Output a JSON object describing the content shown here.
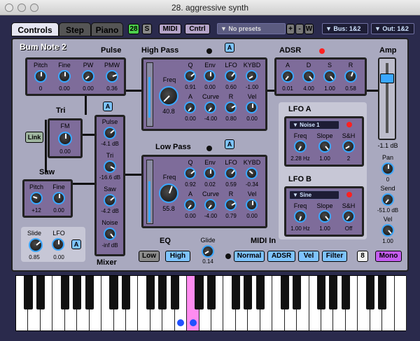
{
  "window": {
    "title": "28. aggressive synth"
  },
  "toolbar": {
    "tabs": [
      "Controls",
      "Step",
      "Piano"
    ],
    "voices": "28",
    "solo": "S",
    "midi": "MIDI",
    "ctrl": "Cntrl",
    "preset": "No presets",
    "preset_buttons": [
      "+",
      "-",
      "W"
    ],
    "bus": "Bus: 1&2",
    "out": "Out: 1&2"
  },
  "patch": {
    "name": "Bum Note 2"
  },
  "pulse": {
    "title": "Pulse",
    "knobs": [
      {
        "label": "Pitch",
        "value": "0"
      },
      {
        "label": "Fine",
        "value": "0.00"
      },
      {
        "label": "PW",
        "value": "0.00"
      },
      {
        "label": "PMW",
        "value": "0.36"
      }
    ]
  },
  "tri": {
    "title": "Tri",
    "knob": {
      "label": "FM",
      "value": "0.00"
    }
  },
  "link": "Link",
  "saw": {
    "title": "Saw",
    "knobs": [
      {
        "label": "Pitch",
        "value": "+12"
      },
      {
        "label": "Fine",
        "value": "0.00"
      }
    ]
  },
  "mixer": {
    "title": "Mixer",
    "knobs": [
      {
        "label": "Pulse",
        "value": "-4.1 dB"
      },
      {
        "label": "Tri",
        "value": "-16.6 dB"
      },
      {
        "label": "Saw",
        "value": "-4.2 dB"
      },
      {
        "label": "Noise",
        "value": "-inf dB"
      }
    ]
  },
  "slide": {
    "label": "Slide",
    "value": "0.85",
    "lfo_label": "LFO",
    "lfo_value": "0.00"
  },
  "highpass": {
    "title": "High Pass",
    "freq_label": "Freq",
    "freq_value": "40.8",
    "row1": [
      {
        "label": "Q",
        "value": "0.91"
      },
      {
        "label": "Env",
        "value": "0.00"
      },
      {
        "label": "LFO",
        "value": "0.60"
      },
      {
        "label": "KYBD",
        "value": "-1.00"
      }
    ],
    "row2": [
      {
        "label": "A",
        "value": "0.00"
      },
      {
        "label": "Curve",
        "value": "-4.00"
      },
      {
        "label": "R",
        "value": "0.80"
      },
      {
        "label": "Vel",
        "value": "0.00"
      }
    ]
  },
  "lowpass": {
    "title": "Low Pass",
    "freq_label": "Freq",
    "freq_value": "55.8",
    "row1": [
      {
        "label": "Q",
        "value": "0.92"
      },
      {
        "label": "Env",
        "value": "0.02"
      },
      {
        "label": "LFO",
        "value": "0.59"
      },
      {
        "label": "KYBD",
        "value": "-0.34"
      }
    ],
    "row2": [
      {
        "label": "A",
        "value": "0.00"
      },
      {
        "label": "Curve",
        "value": "-4.00"
      },
      {
        "label": "R",
        "value": "0.79"
      },
      {
        "label": "Vel",
        "value": "0.00"
      }
    ]
  },
  "adsr": {
    "title": "ADSR",
    "knobs": [
      {
        "label": "A",
        "value": "0.01"
      },
      {
        "label": "D",
        "value": "4.00"
      },
      {
        "label": "S",
        "value": "1.00"
      },
      {
        "label": "R",
        "value": "0.58"
      }
    ]
  },
  "lfoa": {
    "title": "LFO A",
    "wave": "Noise 1",
    "knobs": [
      {
        "label": "Freq",
        "value": "2.28 Hz"
      },
      {
        "label": "Slope",
        "value": "1.00"
      },
      {
        "label": "S&H",
        "value": "2"
      }
    ]
  },
  "lfob": {
    "title": "LFO B",
    "wave": "Sine",
    "knobs": [
      {
        "label": "Freq",
        "value": "1.00 Hz"
      },
      {
        "label": "Slope",
        "value": "1.00"
      },
      {
        "label": "S&H",
        "value": "Off"
      }
    ]
  },
  "amp": {
    "title": "Amp",
    "value": "-1.1 dB",
    "level": 0.82,
    "pan_label": "Pan",
    "pan_value": "0",
    "send_label": "Send",
    "send_value": "-51.0 dB",
    "vel_label": "Vel",
    "vel_value": "1.00"
  },
  "eq": {
    "title": "EQ",
    "low": "Low",
    "high": "High"
  },
  "glide": {
    "label": "Glide",
    "value": "0.14"
  },
  "midiin": {
    "title": "MIDI In",
    "buttons": [
      "Normal",
      "ADSR",
      "Vel",
      "Filter"
    ]
  },
  "poly": "8",
  "mono": "Mono",
  "a_label": "A",
  "colors": {
    "accent": "#3aa7ff",
    "panel": "#7e6c9a",
    "mono": "#c45cf0",
    "active_key": "#ff8cf0"
  }
}
